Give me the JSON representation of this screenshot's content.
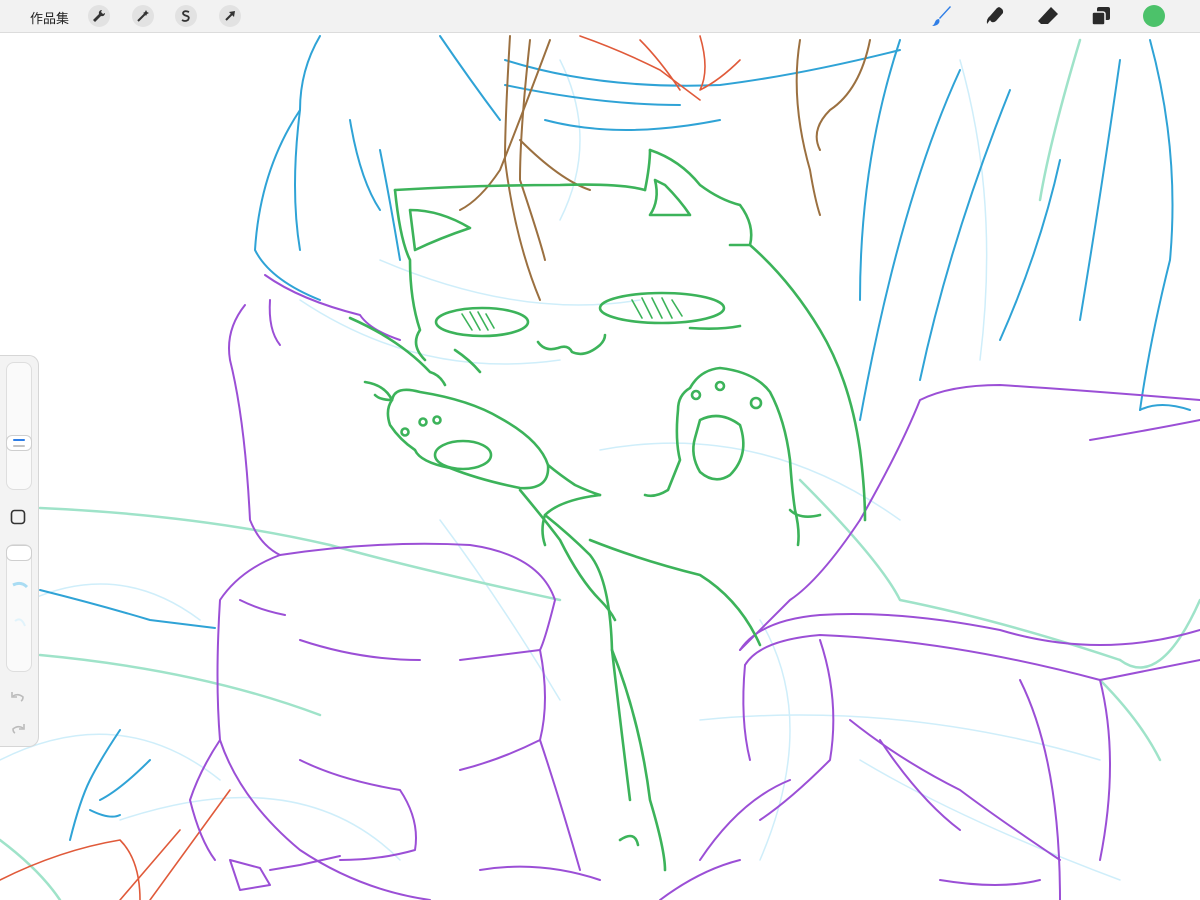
{
  "toolbar": {
    "gallery_label": "作品集",
    "left_tools": [
      "wrench-icon",
      "magic-wand-icon",
      "selection-s-icon",
      "transform-arrow-icon"
    ],
    "right_tools": [
      "brush-icon",
      "smudge-icon",
      "eraser-icon",
      "layers-icon"
    ],
    "current_color": "#4cc26a",
    "active_tool_color": "#2f7ee6"
  },
  "sidebar": {
    "brush_size_level": 0.36,
    "opacity_level": 0.0,
    "modify_button": "square-icon",
    "undo": "undo-icon",
    "redo": "redo-icon"
  },
  "canvas": {
    "stroke_colors": {
      "cat": "#3cb35a",
      "purple": "#9b4fd6",
      "blue": "#2fa3d6",
      "brown": "#9b7040",
      "red": "#e05a3a",
      "mint": "#9fe3c9",
      "lightblue": "#bfe6f5"
    }
  }
}
